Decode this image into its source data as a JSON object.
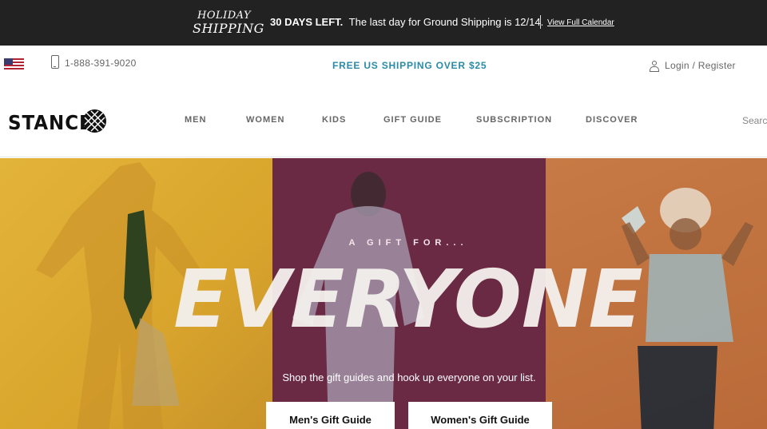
{
  "promo": {
    "logo_line1": "HOLIDAY",
    "logo_line2": "SHIPPING",
    "highlight": "30 DAYS LEFT.",
    "message": "The last day for Ground Shipping is 12/14.",
    "link": "View Full Calendar"
  },
  "utility": {
    "phone": "1-888-391-9020",
    "shipping": "FREE US SHIPPING OVER $25",
    "login": "Login / Register"
  },
  "nav": {
    "brand": "STANCE",
    "items": [
      "MEN",
      "WOMEN",
      "KIDS",
      "GIFT GUIDE",
      "SUBSCRIPTION",
      "DISCOVER"
    ],
    "search_placeholder": "Search"
  },
  "hero": {
    "eyebrow": "A GIFT FOR...",
    "headline": "EVERYONE",
    "subhead": "Shop the gift guides and hook up everyone on your list.",
    "cta_men": "Men's Gift Guide",
    "cta_women": "Women's Gift Guide"
  },
  "colors": {
    "promo_bg": "#222222",
    "accent": "#2a8aa8",
    "panel_left": "#e3b43a",
    "panel_mid": "#6b2a43",
    "panel_right": "#c77a45"
  }
}
